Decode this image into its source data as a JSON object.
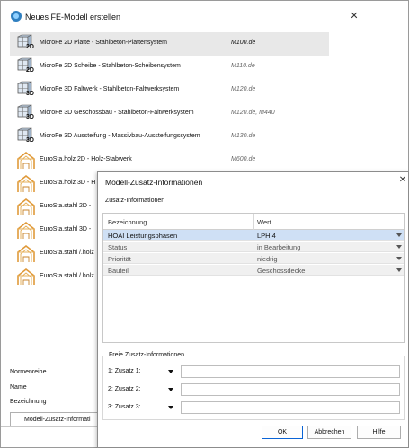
{
  "main_window": {
    "title": "Neues FE-Modell erstellen",
    "close_glyph": "✕",
    "models": [
      {
        "name": "MicroFe 2D Platte - Stahlbeton-Plattensystem",
        "code": "M100.de",
        "icon": "fe-2d-plate-icon",
        "icon_text": "2D",
        "selected": true
      },
      {
        "name": "MicroFe 2D Scheibe - Stahlbeton-Scheibensystem",
        "code": "M110.de",
        "icon": "fe-2d-wall-icon",
        "icon_text": "2D"
      },
      {
        "name": "MicroFe 3D Faltwerk - Stahlbeton-Faltwerksystem",
        "code": "M120.de",
        "icon": "fe-3d-folded-plate-icon",
        "icon_text": "3D"
      },
      {
        "name": "MicroFe 3D Geschossbau - Stahlbeton-Faltwerksystem",
        "code": "M120.de, M440",
        "icon": "fe-3d-storey-icon",
        "icon_text": "3D"
      },
      {
        "name": "MicroFe 3D Aussteifung - Massivbau-Aussteifungssystem",
        "code": "M130.de",
        "icon": "fe-3d-bracing-icon",
        "icon_text": "3D"
      },
      {
        "name": "EuroSta.holz 2D - Holz-Stabwerk",
        "code": "M600.de",
        "icon": "timber-frame-icon",
        "icon_text": ""
      },
      {
        "name": "EuroSta.holz 3D - H",
        "code": "",
        "icon": "timber-frame-icon",
        "icon_text": ""
      },
      {
        "name": "EuroSta.stahl 2D -",
        "code": "",
        "icon": "steel-frame-icon",
        "icon_text": ""
      },
      {
        "name": "EuroSta.stahl 3D -",
        "code": "",
        "icon": "steel-frame-icon",
        "icon_text": ""
      },
      {
        "name": "EuroSta.stahl /.holz",
        "code": "",
        "icon": "steel-timber-frame-icon",
        "icon_text": ""
      },
      {
        "name": "EuroSta.stahl /.holz",
        "code": "",
        "icon": "steel-timber-frame-icon",
        "icon_text": ""
      }
    ],
    "labels": {
      "normenreihe": "Normenreihe",
      "name": "Name",
      "bezeichnung": "Bezeichnung"
    },
    "tab_label": "Modell-Zusatz-Informati"
  },
  "info_dialog": {
    "title": "Modell-Zusatz-Informationen",
    "close_glyph": "✕",
    "section_title": "Zusatz-Informationen",
    "columns": [
      "Bezeichnung",
      "Wert"
    ],
    "rows": [
      {
        "label": "HOAI Leistungsphasen",
        "value": "LPH 4",
        "selected": true
      },
      {
        "label": "Status",
        "value": "in Bearbeitung"
      },
      {
        "label": "Priorität",
        "value": "niedrig"
      },
      {
        "label": "Bauteil",
        "value": "Geschossdecke"
      }
    ],
    "free_section_title": "Freie Zusatz-Informationen",
    "free_rows": [
      {
        "label": "1: Zusatz 1:",
        "value": ""
      },
      {
        "label": "2: Zusatz 2:",
        "value": ""
      },
      {
        "label": "3: Zusatz 3:",
        "value": ""
      }
    ],
    "buttons": {
      "ok": "OK",
      "cancel": "Abbrechen",
      "help": "Hilfe"
    }
  },
  "colors": {
    "selection_gray": "#e8e8e8",
    "grid_selected": "#cfe0f5",
    "default_button_border": "#0a64d6",
    "icon_blue": "#2f7fc0",
    "timber_orange": "#e09a3a"
  }
}
